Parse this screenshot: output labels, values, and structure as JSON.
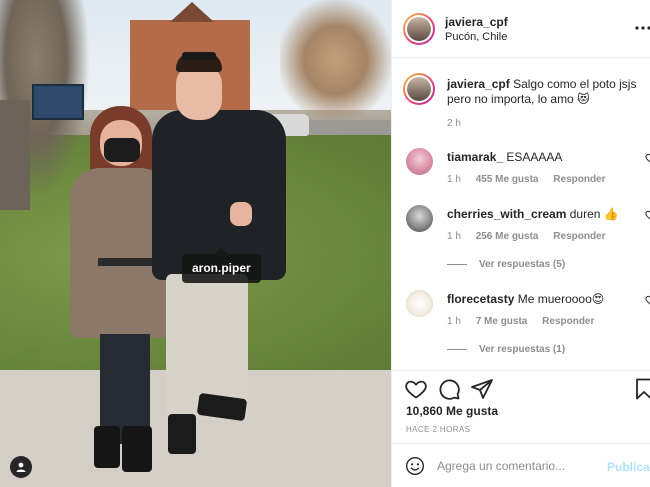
{
  "post": {
    "username": "javiera_cpf",
    "location": "Pucón, Chile",
    "photo_tag": "aron.piper"
  },
  "caption": {
    "username": "javiera_cpf",
    "text": "Salgo como el poto jsjs pero no importa, lo amo 😻",
    "time": "2 h"
  },
  "comments": [
    {
      "username": "tiamarak_",
      "text": "ESAAAAA",
      "time": "1 h",
      "likes": "455 Me gusta",
      "reply": "Responder",
      "replies": ""
    },
    {
      "username": "cherries_with_cream",
      "text": "duren 👍",
      "time": "1 h",
      "likes": "256 Me gusta",
      "reply": "Responder",
      "replies": "Ver respuestas (5)"
    },
    {
      "username": "florecetasty",
      "text": "Me mueroooo😍",
      "time": "1 h",
      "likes": "7 Me gusta",
      "reply": "Responder",
      "replies": "Ver respuestas (1)"
    }
  ],
  "actions": {
    "likes": "10,860 Me gusta",
    "posted": "HACE 2 HORAS"
  },
  "add_comment": {
    "placeholder": "Agrega un comentario...",
    "publish": "Publicar"
  },
  "icons": {
    "more": "more-dots-icon",
    "heart": "heart-icon",
    "comment": "comment-bubble-icon",
    "share": "paper-plane-icon",
    "save": "bookmark-icon",
    "emoji": "emoji-smile-icon",
    "tagged": "person-tag-icon"
  },
  "colors": {
    "text": "#262626",
    "muted": "#8e8e8e",
    "publish_disabled": "#b2dffc",
    "border": "#efefef"
  }
}
